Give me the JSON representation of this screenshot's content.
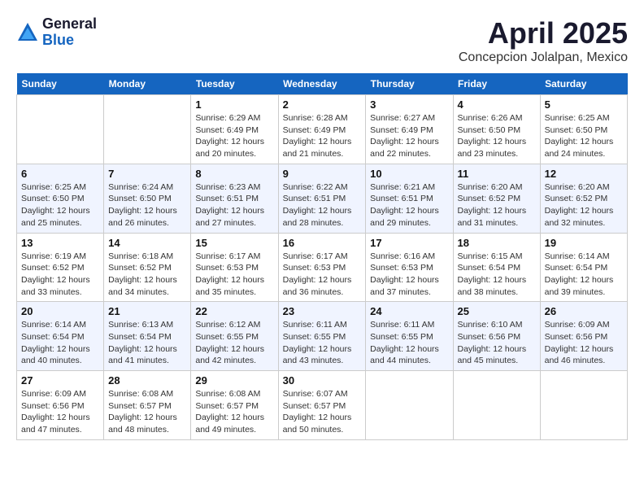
{
  "header": {
    "logo_general": "General",
    "logo_blue": "Blue",
    "month_title": "April 2025",
    "location": "Concepcion Jolalpan, Mexico"
  },
  "days_of_week": [
    "Sunday",
    "Monday",
    "Tuesday",
    "Wednesday",
    "Thursday",
    "Friday",
    "Saturday"
  ],
  "weeks": [
    [
      {
        "num": "",
        "sunrise": "",
        "sunset": "",
        "daylight": ""
      },
      {
        "num": "",
        "sunrise": "",
        "sunset": "",
        "daylight": ""
      },
      {
        "num": "1",
        "sunrise": "Sunrise: 6:29 AM",
        "sunset": "Sunset: 6:49 PM",
        "daylight": "Daylight: 12 hours and 20 minutes."
      },
      {
        "num": "2",
        "sunrise": "Sunrise: 6:28 AM",
        "sunset": "Sunset: 6:49 PM",
        "daylight": "Daylight: 12 hours and 21 minutes."
      },
      {
        "num": "3",
        "sunrise": "Sunrise: 6:27 AM",
        "sunset": "Sunset: 6:49 PM",
        "daylight": "Daylight: 12 hours and 22 minutes."
      },
      {
        "num": "4",
        "sunrise": "Sunrise: 6:26 AM",
        "sunset": "Sunset: 6:50 PM",
        "daylight": "Daylight: 12 hours and 23 minutes."
      },
      {
        "num": "5",
        "sunrise": "Sunrise: 6:25 AM",
        "sunset": "Sunset: 6:50 PM",
        "daylight": "Daylight: 12 hours and 24 minutes."
      }
    ],
    [
      {
        "num": "6",
        "sunrise": "Sunrise: 6:25 AM",
        "sunset": "Sunset: 6:50 PM",
        "daylight": "Daylight: 12 hours and 25 minutes."
      },
      {
        "num": "7",
        "sunrise": "Sunrise: 6:24 AM",
        "sunset": "Sunset: 6:50 PM",
        "daylight": "Daylight: 12 hours and 26 minutes."
      },
      {
        "num": "8",
        "sunrise": "Sunrise: 6:23 AM",
        "sunset": "Sunset: 6:51 PM",
        "daylight": "Daylight: 12 hours and 27 minutes."
      },
      {
        "num": "9",
        "sunrise": "Sunrise: 6:22 AM",
        "sunset": "Sunset: 6:51 PM",
        "daylight": "Daylight: 12 hours and 28 minutes."
      },
      {
        "num": "10",
        "sunrise": "Sunrise: 6:21 AM",
        "sunset": "Sunset: 6:51 PM",
        "daylight": "Daylight: 12 hours and 29 minutes."
      },
      {
        "num": "11",
        "sunrise": "Sunrise: 6:20 AM",
        "sunset": "Sunset: 6:52 PM",
        "daylight": "Daylight: 12 hours and 31 minutes."
      },
      {
        "num": "12",
        "sunrise": "Sunrise: 6:20 AM",
        "sunset": "Sunset: 6:52 PM",
        "daylight": "Daylight: 12 hours and 32 minutes."
      }
    ],
    [
      {
        "num": "13",
        "sunrise": "Sunrise: 6:19 AM",
        "sunset": "Sunset: 6:52 PM",
        "daylight": "Daylight: 12 hours and 33 minutes."
      },
      {
        "num": "14",
        "sunrise": "Sunrise: 6:18 AM",
        "sunset": "Sunset: 6:52 PM",
        "daylight": "Daylight: 12 hours and 34 minutes."
      },
      {
        "num": "15",
        "sunrise": "Sunrise: 6:17 AM",
        "sunset": "Sunset: 6:53 PM",
        "daylight": "Daylight: 12 hours and 35 minutes."
      },
      {
        "num": "16",
        "sunrise": "Sunrise: 6:17 AM",
        "sunset": "Sunset: 6:53 PM",
        "daylight": "Daylight: 12 hours and 36 minutes."
      },
      {
        "num": "17",
        "sunrise": "Sunrise: 6:16 AM",
        "sunset": "Sunset: 6:53 PM",
        "daylight": "Daylight: 12 hours and 37 minutes."
      },
      {
        "num": "18",
        "sunrise": "Sunrise: 6:15 AM",
        "sunset": "Sunset: 6:54 PM",
        "daylight": "Daylight: 12 hours and 38 minutes."
      },
      {
        "num": "19",
        "sunrise": "Sunrise: 6:14 AM",
        "sunset": "Sunset: 6:54 PM",
        "daylight": "Daylight: 12 hours and 39 minutes."
      }
    ],
    [
      {
        "num": "20",
        "sunrise": "Sunrise: 6:14 AM",
        "sunset": "Sunset: 6:54 PM",
        "daylight": "Daylight: 12 hours and 40 minutes."
      },
      {
        "num": "21",
        "sunrise": "Sunrise: 6:13 AM",
        "sunset": "Sunset: 6:54 PM",
        "daylight": "Daylight: 12 hours and 41 minutes."
      },
      {
        "num": "22",
        "sunrise": "Sunrise: 6:12 AM",
        "sunset": "Sunset: 6:55 PM",
        "daylight": "Daylight: 12 hours and 42 minutes."
      },
      {
        "num": "23",
        "sunrise": "Sunrise: 6:11 AM",
        "sunset": "Sunset: 6:55 PM",
        "daylight": "Daylight: 12 hours and 43 minutes."
      },
      {
        "num": "24",
        "sunrise": "Sunrise: 6:11 AM",
        "sunset": "Sunset: 6:55 PM",
        "daylight": "Daylight: 12 hours and 44 minutes."
      },
      {
        "num": "25",
        "sunrise": "Sunrise: 6:10 AM",
        "sunset": "Sunset: 6:56 PM",
        "daylight": "Daylight: 12 hours and 45 minutes."
      },
      {
        "num": "26",
        "sunrise": "Sunrise: 6:09 AM",
        "sunset": "Sunset: 6:56 PM",
        "daylight": "Daylight: 12 hours and 46 minutes."
      }
    ],
    [
      {
        "num": "27",
        "sunrise": "Sunrise: 6:09 AM",
        "sunset": "Sunset: 6:56 PM",
        "daylight": "Daylight: 12 hours and 47 minutes."
      },
      {
        "num": "28",
        "sunrise": "Sunrise: 6:08 AM",
        "sunset": "Sunset: 6:57 PM",
        "daylight": "Daylight: 12 hours and 48 minutes."
      },
      {
        "num": "29",
        "sunrise": "Sunrise: 6:08 AM",
        "sunset": "Sunset: 6:57 PM",
        "daylight": "Daylight: 12 hours and 49 minutes."
      },
      {
        "num": "30",
        "sunrise": "Sunrise: 6:07 AM",
        "sunset": "Sunset: 6:57 PM",
        "daylight": "Daylight: 12 hours and 50 minutes."
      },
      {
        "num": "",
        "sunrise": "",
        "sunset": "",
        "daylight": ""
      },
      {
        "num": "",
        "sunrise": "",
        "sunset": "",
        "daylight": ""
      },
      {
        "num": "",
        "sunrise": "",
        "sunset": "",
        "daylight": ""
      }
    ]
  ]
}
